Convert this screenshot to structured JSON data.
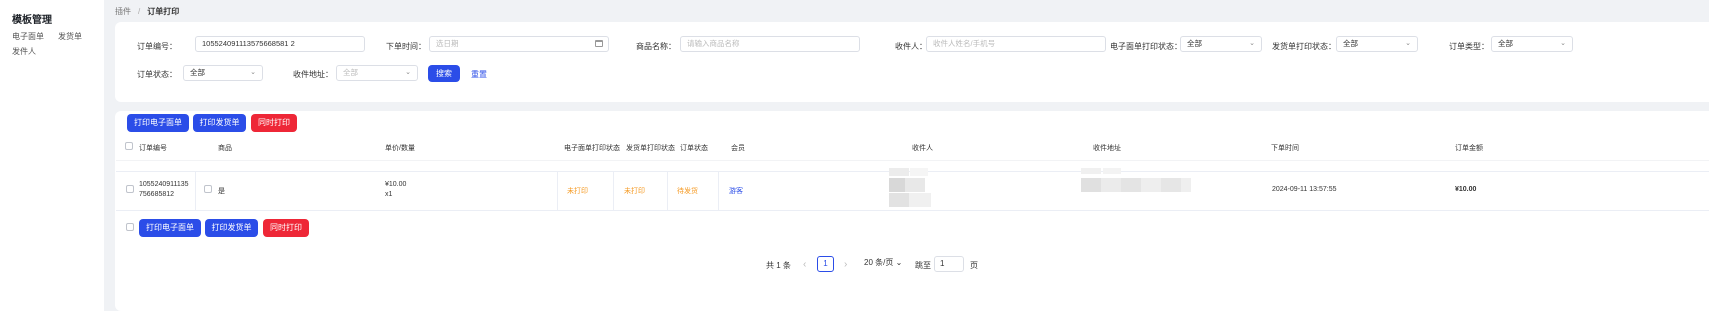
{
  "sidebar": {
    "title": "模板管理",
    "items": [
      {
        "label": "电子面单"
      },
      {
        "label": "发货单"
      },
      {
        "label": "发件人"
      }
    ]
  },
  "breadcrumb": {
    "root": "插件",
    "sep": "/",
    "current": "订单打印"
  },
  "filters": {
    "order_no": {
      "label": "订单编号：",
      "value": "105524091113575668581 2"
    },
    "order_time": {
      "label": "下单时间：",
      "placeholder": "选日期"
    },
    "product_name": {
      "label": "商品名称：",
      "placeholder": "请输入商品名称"
    },
    "receiver": {
      "label": "收件人：",
      "placeholder": "收件人姓名/手机号"
    },
    "waybill_status": {
      "label": "电子面单打印状态：",
      "value": "全部"
    },
    "delivery_status": {
      "label": "发货单打印状态：",
      "value": "全部"
    },
    "order_type": {
      "label": "订单类型：",
      "value": "全部"
    },
    "order_status": {
      "label": "订单状态：",
      "value": "全部"
    },
    "address": {
      "label": "收件地址：",
      "placeholder": "全部"
    },
    "search_label": "搜索",
    "reset_label": "重置"
  },
  "actions": {
    "print_waybill": "打印电子面单",
    "print_delivery": "打印发货单",
    "print_both": "同时打印"
  },
  "table": {
    "headers": {
      "order_no": "订单编号",
      "product": "商品",
      "price_qty": "单价/数量",
      "waybill_status": "电子面单打印状态",
      "delivery_status": "发货单打印状态",
      "order_status": "订单状态",
      "member": "会员",
      "receiver": "收件人",
      "address": "收件地址",
      "order_time": "下单时间",
      "amount": "订单金额"
    },
    "rows": [
      {
        "order_no_line1": "1055240911135",
        "order_no_line2": "756685812",
        "product": "是",
        "price": "¥10.00",
        "qty": "x1",
        "waybill_status": "未打印",
        "delivery_status": "未打印",
        "order_status": "待发货",
        "member": "游客",
        "order_time": "2024-09-11 13:57:55",
        "amount": "¥10.00"
      }
    ]
  },
  "pagination": {
    "total": "共 1 条",
    "prev": "‹",
    "current_page": "1",
    "next": "›",
    "page_size": "20 条/页",
    "jump_label": "跳至",
    "jump_value": "1",
    "page_unit": "页"
  },
  "colors": {
    "primary": "#2b4de8",
    "danger": "#ee2737",
    "warning": "#f59a23"
  }
}
